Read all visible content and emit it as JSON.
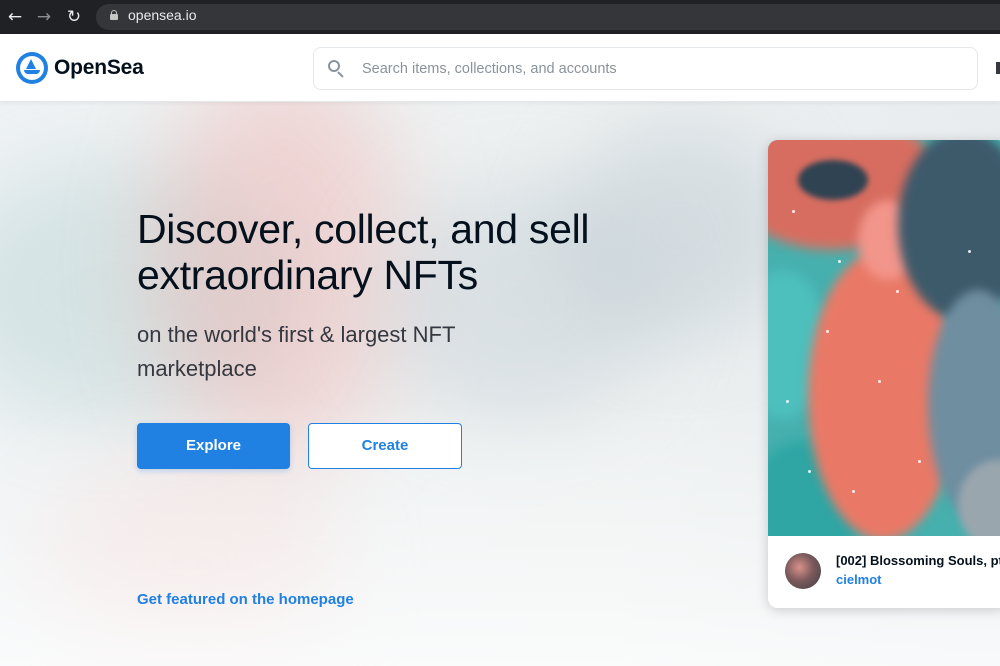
{
  "browser": {
    "url": "opensea.io",
    "back_glyph": "←",
    "forward_glyph": "→",
    "reload_glyph": "↻"
  },
  "header": {
    "brand": "OpenSea",
    "logo_icon": "opensea-logo-icon",
    "search_placeholder": "Search items, collections, and accounts",
    "search_value": ""
  },
  "hero": {
    "headline": "Discover, collect, and sell extraordinary NFTs",
    "subhead": "on the world's first & largest NFT marketplace",
    "explore_label": "Explore",
    "create_label": "Create",
    "featured_link": "Get featured on the homepage"
  },
  "featured_card": {
    "title": "[002] Blossoming Souls, pt",
    "creator": "cielmot"
  },
  "colors": {
    "accent": "#2081e2",
    "text_dark": "#04111d",
    "chrome_bg": "#202124"
  }
}
